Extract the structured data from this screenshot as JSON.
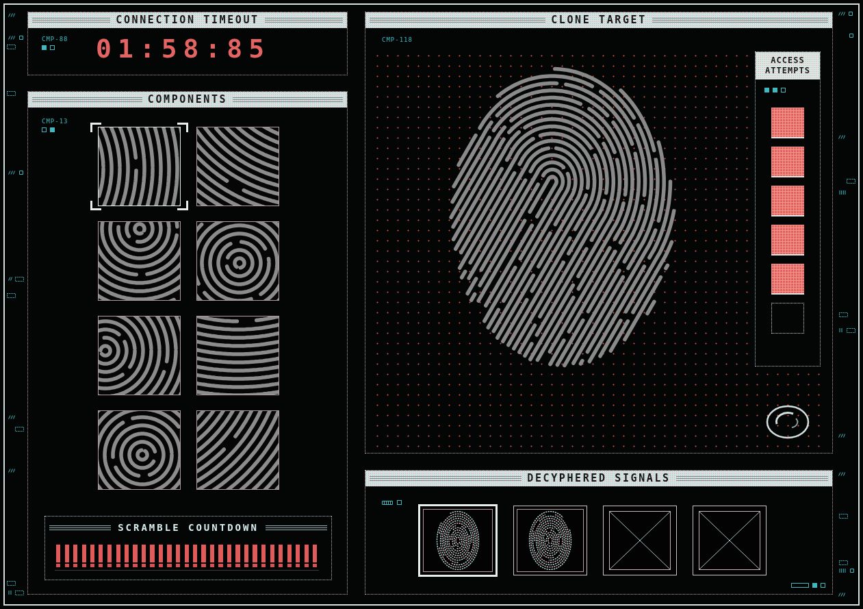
{
  "connection_timeout": {
    "title": "CONNECTION TIMEOUT",
    "code": "CMP-88",
    "indicators": [
      {
        "on": true
      },
      {
        "on": false
      }
    ],
    "timer": "01:58:85"
  },
  "components": {
    "title": "COMPONENTS",
    "code": "CMP-13",
    "indicators": [
      {
        "on": false
      },
      {
        "on": true
      }
    ],
    "tiles": [
      {
        "selected": true
      },
      {
        "selected": false
      },
      {
        "selected": false
      },
      {
        "selected": false
      },
      {
        "selected": false
      },
      {
        "selected": false
      },
      {
        "selected": false
      },
      {
        "selected": false
      }
    ]
  },
  "scramble_countdown": {
    "title": "SCRAMBLE COUNTDOWN",
    "level": 1
  },
  "clone_target": {
    "title": "CLONE TARGET",
    "code": "CMP-118",
    "access_attempts": {
      "title": "ACCESS ATTEMPTS",
      "indicators": [
        {
          "on": true
        },
        {
          "on": true
        },
        {
          "on": false
        }
      ],
      "slots": [
        {
          "filled": true
        },
        {
          "filled": true
        },
        {
          "filled": true
        },
        {
          "filled": true
        },
        {
          "filled": true
        },
        {
          "filled": false
        }
      ]
    }
  },
  "decyphered_signals": {
    "title": "DECYPHERED SIGNALS",
    "indicators": [
      {
        "on": false
      }
    ],
    "slots": [
      {
        "kind": "fingerprint",
        "selected": true
      },
      {
        "kind": "fingerprint",
        "selected": false
      },
      {
        "kind": "empty",
        "selected": false
      },
      {
        "kind": "empty",
        "selected": false
      }
    ],
    "footer_indicators": [
      {
        "on": true
      },
      {
        "on": false
      }
    ]
  }
}
